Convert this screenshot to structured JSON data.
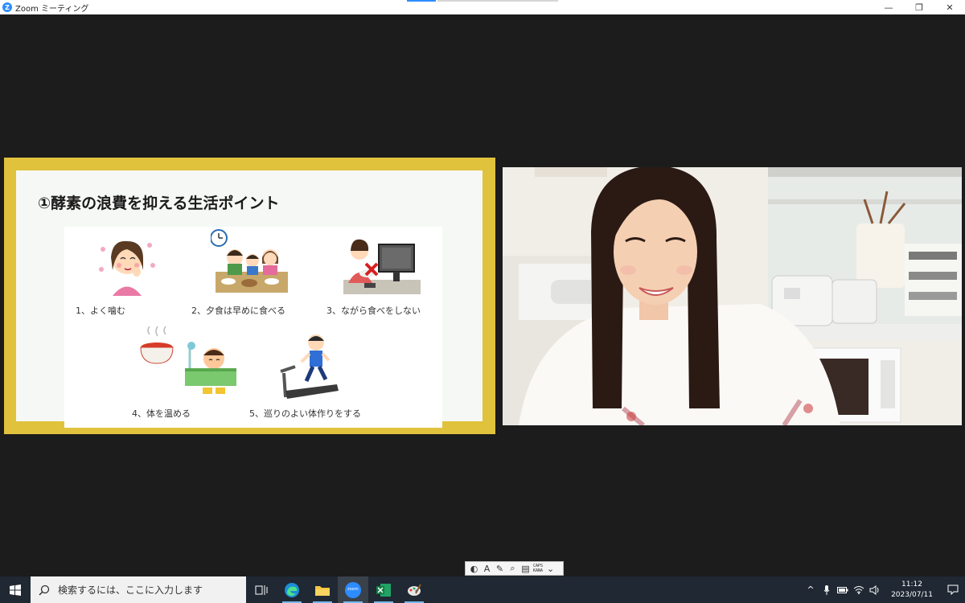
{
  "window": {
    "title": "Zoom ミーティング",
    "app_icon_letter": "Z",
    "controls": {
      "minimize": "—",
      "restore": "❐",
      "close": "✕"
    }
  },
  "slide": {
    "title": "①酵素の浪費を抑える生活ポイント",
    "items": [
      {
        "label": "1、よく噛む"
      },
      {
        "label": "2、夕食は早めに食べる"
      },
      {
        "label": "3、ながら食べをしない"
      },
      {
        "label": "4、体を温める"
      },
      {
        "label": "5、巡りのよい体作りをする"
      }
    ]
  },
  "ime_toolbar": {
    "mode_glyph": "A",
    "caps_label": "CAPS",
    "kana_label": "KANA"
  },
  "taskbar": {
    "search_placeholder": "検索するには、ここに入力します",
    "zoom_label": "zoom",
    "clock_time": "11:12",
    "clock_date": "2023/07/11"
  },
  "colors": {
    "slide_border": "#e0c23c",
    "taskbar": "#1f2833",
    "zoom_blue": "#2d8cff"
  }
}
